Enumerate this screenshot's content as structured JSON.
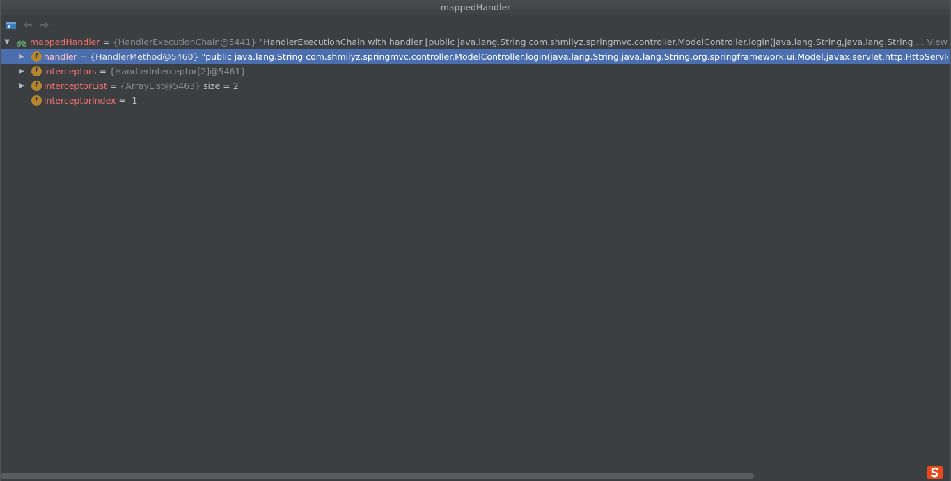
{
  "window": {
    "title": "mappedHandler"
  },
  "toolbar": {
    "buttons": [
      {
        "name": "restore-layout",
        "icon": "layout-icon"
      },
      {
        "name": "back",
        "icon": "arrow-left-icon"
      },
      {
        "name": "forward",
        "icon": "arrow-right-icon"
      }
    ]
  },
  "tree": {
    "root": {
      "name": "mappedHandler",
      "eq": " = ",
      "ref": "{HandlerExecutionChain@5441}",
      "value": " \"HandlerExecutionChain with handler [public java.lang.String com.shmilyz.springmvc.controller.ModelController.login(java.lang.String,java.lang.String,org.springframewor",
      "ellipsis": "... View",
      "icon": "watch-glasses-icon"
    },
    "children": [
      {
        "name": "handler",
        "eq": " = ",
        "ref": "{HandlerMethod@5460}",
        "value": " \"public java.lang.String com.shmilyz.springmvc.controller.ModelController.login(java.lang.String,java.lang.String,org.springframework.ui.Model,javax.servlet.http.HttpServletRequest)\"",
        "icon_letter": "f",
        "selected": true
      },
      {
        "name": "interceptors",
        "eq": " = ",
        "ref": "{HandlerInterceptor[2]@5461}",
        "value": "",
        "icon_letter": "f"
      },
      {
        "name": "interceptorList",
        "eq": " = ",
        "ref": "{ArrayList@5463}",
        "value": "  size = 2",
        "icon_letter": "f"
      },
      {
        "name": "interceptorIndex",
        "eq": " = ",
        "ref": "",
        "value": "-1",
        "icon_letter": "f"
      }
    ]
  },
  "colors": {
    "background": "#3c3f41",
    "selection": "#4b6eaf",
    "variable_name": "#ef6f6f",
    "field_icon": "#b5862d",
    "reference": "#8c8c8c"
  },
  "overlay": {
    "ime_logo_letter": "S"
  }
}
